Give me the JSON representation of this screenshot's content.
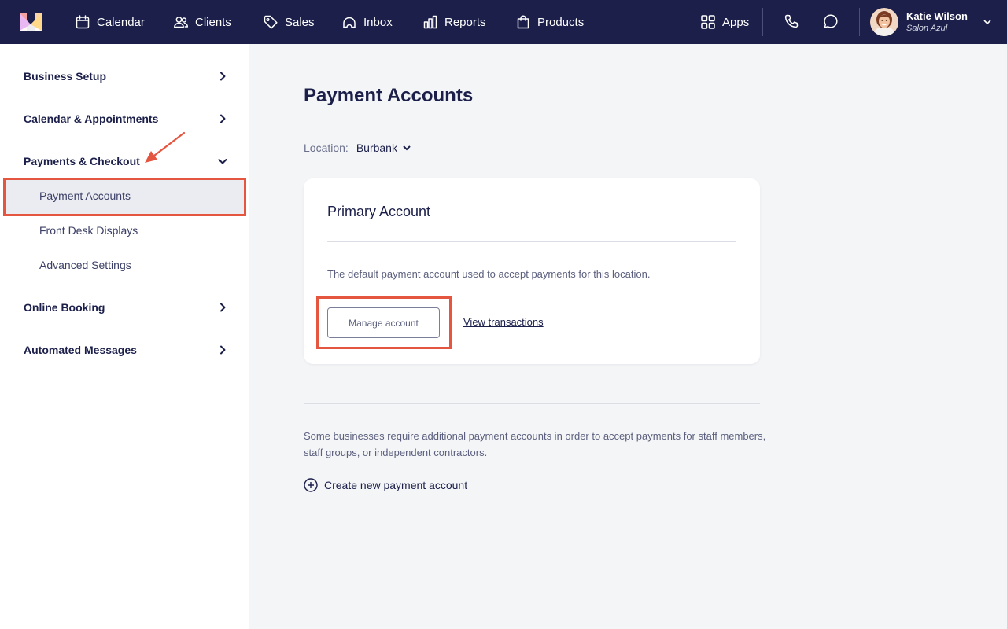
{
  "nav": {
    "logo": "mangomint-logo",
    "items": [
      {
        "label": "Calendar",
        "icon": "calendar-icon"
      },
      {
        "label": "Clients",
        "icon": "users-icon"
      },
      {
        "label": "Sales",
        "icon": "tag-icon"
      },
      {
        "label": "Inbox",
        "icon": "inbox-icon"
      },
      {
        "label": "Reports",
        "icon": "bar-chart-icon"
      },
      {
        "label": "Products",
        "icon": "shopping-bag-icon"
      }
    ],
    "apps_label": "Apps",
    "user": {
      "name": "Katie Wilson",
      "business": "Salon Azul"
    }
  },
  "sidebar": {
    "sections": [
      {
        "label": "Business Setup",
        "expanded": false
      },
      {
        "label": "Calendar & Appointments",
        "expanded": false
      },
      {
        "label": "Payments & Checkout",
        "expanded": true,
        "items": [
          "Payment Accounts",
          "Front Desk Displays",
          "Advanced Settings"
        ]
      },
      {
        "label": "Online Booking",
        "expanded": false
      },
      {
        "label": "Automated Messages",
        "expanded": false
      }
    ],
    "active_item": "Payment Accounts"
  },
  "main": {
    "title": "Payment Accounts",
    "location_label": "Location:",
    "location_value": "Burbank",
    "primary_card": {
      "title": "Primary Account",
      "description": "The default payment account used to accept payments for this location.",
      "manage_button": "Manage account",
      "view_link": "View transactions"
    },
    "info_text": "Some businesses require additional payment accounts in order to accept payments for staff members, staff groups, or independent contractors.",
    "create_link": "Create new payment account"
  },
  "colors": {
    "nav_bg": "#1b1f4a",
    "annotation": "#e4563f",
    "active_bg": "#ebecf2",
    "page_bg": "#f4f5f7"
  }
}
